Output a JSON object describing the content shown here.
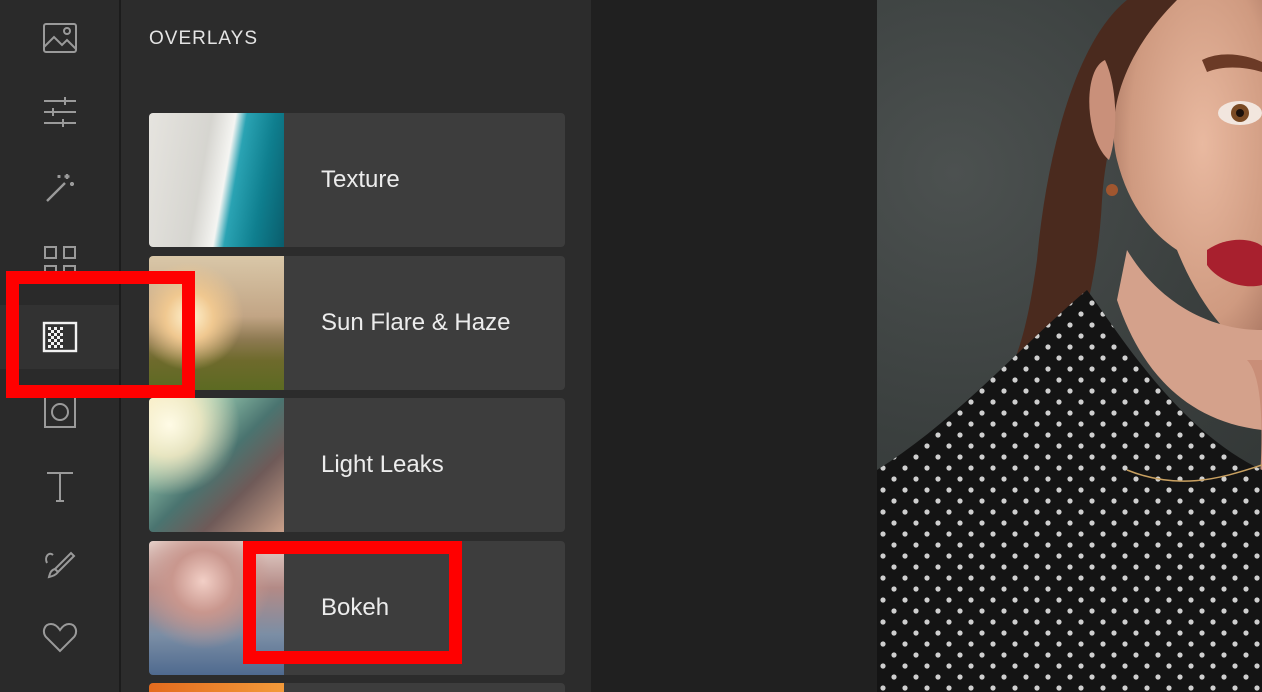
{
  "panel": {
    "title": "OVERLAYS"
  },
  "rail": {
    "items": [
      {
        "icon": "image-icon"
      },
      {
        "icon": "sliders-icon"
      },
      {
        "icon": "magic-wand-icon"
      },
      {
        "icon": "grid-icon"
      },
      {
        "icon": "overlays-icon",
        "active": true
      },
      {
        "icon": "frame-icon"
      },
      {
        "icon": "text-icon"
      },
      {
        "icon": "brush-icon"
      },
      {
        "icon": "heart-icon"
      }
    ]
  },
  "overlays": [
    {
      "label": "Texture"
    },
    {
      "label": "Sun Flare & Haze"
    },
    {
      "label": "Light Leaks"
    },
    {
      "label": "Bokeh"
    }
  ],
  "annotation": {
    "color": "#ff0000"
  }
}
